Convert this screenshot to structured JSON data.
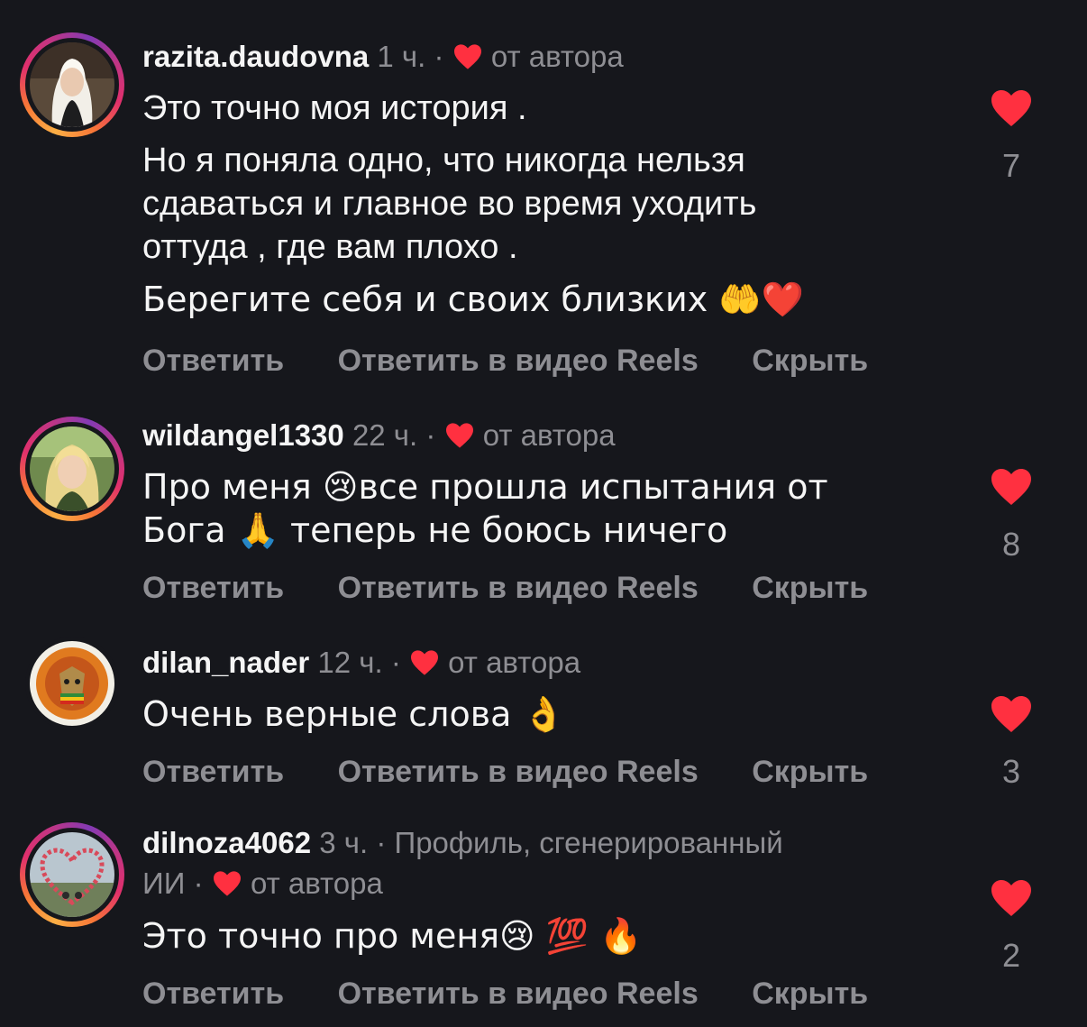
{
  "colors": {
    "background": "#16171c",
    "heart": "#ff3040",
    "muted": "#8e8e93",
    "text": "#f5f5f5"
  },
  "comments": [
    {
      "username": "razita.daudovna",
      "time": "1 ч.",
      "by_author": "от автора",
      "paragraphs": [
        "Это точно моя история .",
        "Но я поняла одно, что никогда нельзя",
        "сдаваться и главное во время уходить",
        "оттуда , где вам плохо .",
        "Берегите себя и своих близких 🤲❤️"
      ],
      "likes": "7",
      "actions": {
        "reply": "Ответить",
        "reply_reels": "Ответить в видео Reels",
        "hide": "Скрыть"
      }
    },
    {
      "username": "wildangel1330",
      "time": "22 ч.",
      "by_author": "от автора",
      "paragraphs": [
        "Про меня 😢все прошла испытания от",
        "Бога 🙏 теперь не боюсь ничего"
      ],
      "likes": "8",
      "actions": {
        "reply": "Ответить",
        "reply_reels": "Ответить в видео Reels",
        "hide": "Скрыть"
      }
    },
    {
      "username": "dilan_nader",
      "time": "12 ч.",
      "by_author": "от автора",
      "paragraphs": [
        "Очень верные слова 👌"
      ],
      "likes": "3",
      "actions": {
        "reply": "Ответить",
        "reply_reels": "Ответить в видео Reels",
        "hide": "Скрыть"
      }
    },
    {
      "username": "dilnoza4062",
      "time": "3 ч.",
      "ai_label": "Профиль, сгенерированный",
      "ai_label_2": "ИИ",
      "by_author": "от автора",
      "paragraphs": [
        "Это точно про меня😢 💯 🔥"
      ],
      "likes": "2",
      "actions": {
        "reply": "Ответить",
        "reply_reels": "Ответить в видео Reels",
        "hide": "Скрыть"
      }
    }
  ]
}
